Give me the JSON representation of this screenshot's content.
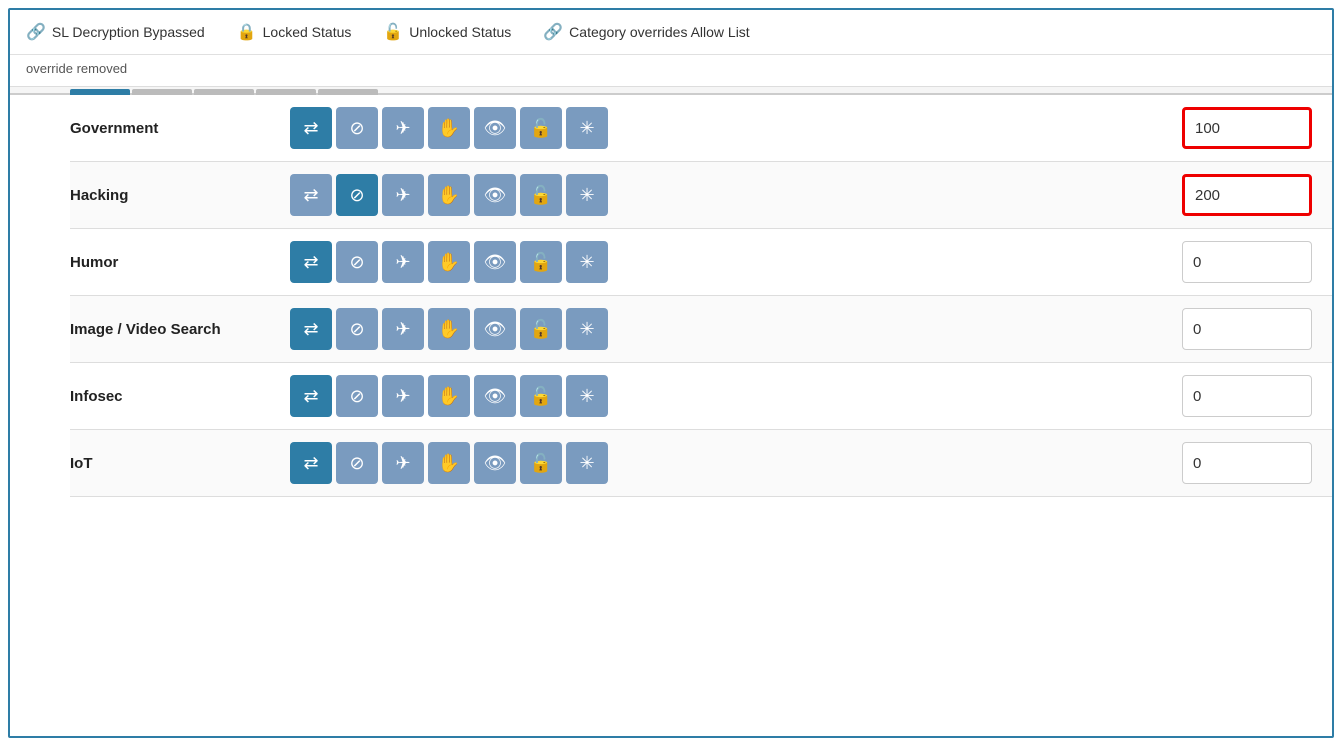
{
  "legend": {
    "items": [
      {
        "id": "ssl-bypass",
        "icon": "🔗",
        "label": "SL Decryption Bypassed"
      },
      {
        "id": "locked",
        "icon": "🔒",
        "label": "Locked Status"
      },
      {
        "id": "unlocked",
        "icon": "🔓",
        "label": "Unlocked Status"
      },
      {
        "id": "override",
        "icon": "🔗",
        "label": "Category overrides Allow List"
      }
    ]
  },
  "subtitle": "override removed",
  "tabs": [
    {
      "id": "t1",
      "active": true
    },
    {
      "id": "t2",
      "active": false
    },
    {
      "id": "t3",
      "active": false
    },
    {
      "id": "t4",
      "active": false
    },
    {
      "id": "t5",
      "active": false
    }
  ],
  "rows": [
    {
      "id": "government",
      "label": "Government",
      "activeIcon": 0,
      "value": "100",
      "highlighted": true
    },
    {
      "id": "hacking",
      "label": "Hacking",
      "activeIcon": 1,
      "value": "200",
      "highlighted": true
    },
    {
      "id": "humor",
      "label": "Humor",
      "activeIcon": 0,
      "value": "0",
      "highlighted": false
    },
    {
      "id": "image-video-search",
      "label": "Image / Video Search",
      "activeIcon": 0,
      "value": "0",
      "highlighted": false
    },
    {
      "id": "infosec",
      "label": "Infosec",
      "activeIcon": 0,
      "value": "0",
      "highlighted": false
    },
    {
      "id": "iot",
      "label": "IoT",
      "activeIcon": 0,
      "value": "0",
      "highlighted": false
    }
  ],
  "icons": [
    {
      "name": "transfer",
      "symbol": "⇄",
      "title": "Transfer"
    },
    {
      "name": "block",
      "symbol": "⊘",
      "title": "Block"
    },
    {
      "name": "airplane",
      "symbol": "✈",
      "title": "Bypass"
    },
    {
      "name": "hand",
      "symbol": "✋",
      "title": "Warn"
    },
    {
      "name": "eye",
      "symbol": "👁",
      "title": "Monitor"
    },
    {
      "name": "unlock",
      "symbol": "🔓",
      "title": "Allow"
    },
    {
      "name": "spark",
      "symbol": "✳",
      "title": "Decrypt"
    }
  ]
}
